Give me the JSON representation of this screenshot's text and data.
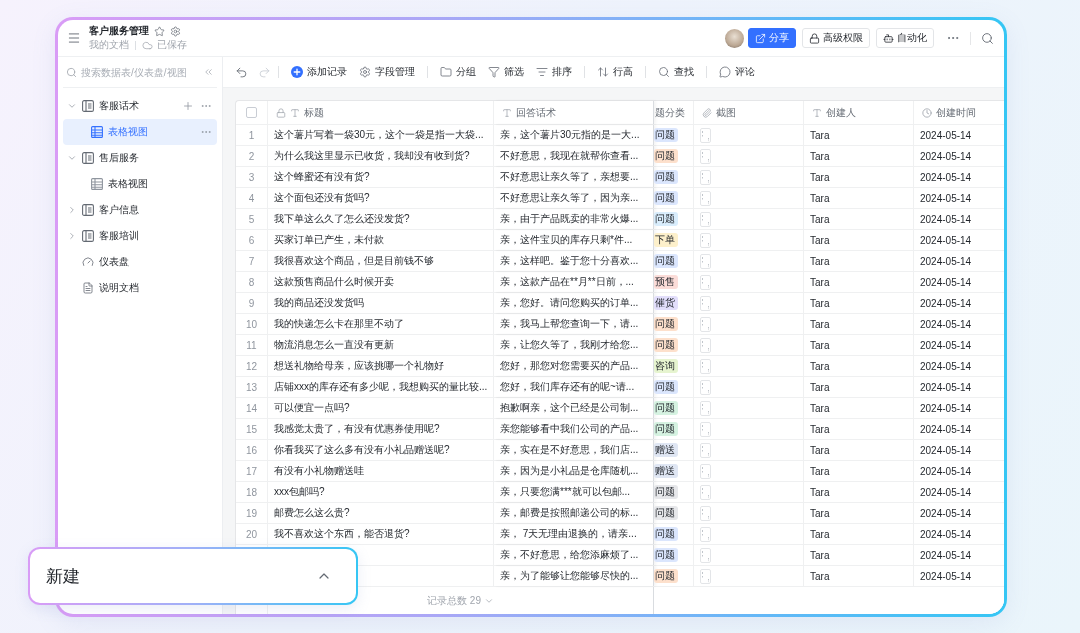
{
  "header": {
    "title": "客户服务管理",
    "location": "我的文档",
    "save_status": "已保存",
    "buttons": [
      {
        "label": "分享",
        "kind": "primary"
      },
      {
        "label": "高级权限",
        "kind": "outline"
      },
      {
        "label": "自动化",
        "kind": "outline"
      }
    ]
  },
  "sidebar": {
    "search": {
      "placeholder": "搜索数据表/仪表盘/视图"
    },
    "items": [
      {
        "label": "客服话术",
        "kind": "table",
        "expanded": true,
        "selected": false,
        "hovered": true,
        "children": [
          {
            "label": "表格视图",
            "kind": "view",
            "selected": true
          }
        ]
      },
      {
        "label": "售后服务",
        "kind": "table",
        "expanded": true,
        "selected": false,
        "hovered": false,
        "children": [
          {
            "label": "表格视图",
            "kind": "view",
            "selected": false
          }
        ]
      },
      {
        "label": "客户信息",
        "kind": "table",
        "expanded": false,
        "selected": false,
        "hovered": false
      },
      {
        "label": "客服培训",
        "kind": "table",
        "expanded": false,
        "selected": false,
        "hovered": false
      },
      {
        "label": "仪表盘",
        "kind": "dashboard",
        "selected": false,
        "hovered": false
      },
      {
        "label": "说明文档",
        "kind": "doc",
        "selected": false,
        "hovered": false
      }
    ]
  },
  "toolbar": {
    "actions": [
      {
        "label": "添加记录"
      },
      {
        "label": "字段管理"
      },
      {
        "label": "分组"
      },
      {
        "label": "筛选"
      },
      {
        "label": "排序"
      },
      {
        "label": "行高"
      },
      {
        "label": "查找"
      },
      {
        "label": "评论"
      }
    ]
  },
  "table": {
    "header_checkbox": {
      "checked": false
    },
    "columns": [
      {
        "label": "标题",
        "kind": "primary"
      },
      {
        "label": "回答话术",
        "kind": "text"
      },
      {
        "label": "题分类",
        "kind": "select"
      },
      {
        "label": "截图",
        "kind": "attachment"
      },
      {
        "label": "创建人",
        "kind": "text"
      },
      {
        "label": "创建时间",
        "kind": "date"
      }
    ],
    "rows": [
      {
        "number": "1",
        "title": "这个薯片写着一袋30元，这个一袋是指一大袋...",
        "answer": "亲，这个薯片30元指的是一大...",
        "category": {
          "label": "问题",
          "color": "#dbe6fd"
        },
        "creator": "Tara",
        "created": "2024-05-14"
      },
      {
        "number": "2",
        "title": "为什么我这里显示已收货，我却没有收到货?",
        "answer": "不好意思，我现在就帮你查看...",
        "category": {
          "label": "问题",
          "color": "#fde0cc"
        },
        "creator": "Tara",
        "created": "2024-05-14"
      },
      {
        "number": "3",
        "title": "这个蜂蜜还有没有货?",
        "answer": "不好意思让亲久等了，亲想要...",
        "category": {
          "label": "问题",
          "color": "#dbe6fd"
        },
        "creator": "Tara",
        "created": "2024-05-14"
      },
      {
        "number": "4",
        "title": "这个面包还没有货吗?",
        "answer": "不好意思让亲久等了，因为亲...",
        "category": {
          "label": "问题",
          "color": "#dbe6fd"
        },
        "creator": "Tara",
        "created": "2024-05-14"
      },
      {
        "number": "5",
        "title": "我下单这么久了怎么还没发货?",
        "answer": "亲，由于产品既卖的非常火爆...",
        "category": {
          "label": "问题",
          "color": "#d9edfc"
        },
        "creator": "Tara",
        "created": "2024-05-14"
      },
      {
        "number": "6",
        "title": "买家订单已产生，未付款",
        "answer": "亲，这件宝贝的库存只剩*件...",
        "category": {
          "label": "下单",
          "color": "#fdf0cb"
        },
        "creator": "Tara",
        "created": "2024-05-14"
      },
      {
        "number": "7",
        "title": "我很喜欢这个商品，但是目前钱不够",
        "answer": "亲，这样吧。鉴于您十分喜欢...",
        "category": {
          "label": "问题",
          "color": "#dbe6fd"
        },
        "creator": "Tara",
        "created": "2024-05-14"
      },
      {
        "number": "8",
        "title": "这款预售商品什么时候开卖",
        "answer": "亲，这款产品在**月**日前，...",
        "category": {
          "label": "预售",
          "color": "#fbdcd8"
        },
        "creator": "Tara",
        "created": "2024-05-14"
      },
      {
        "number": "9",
        "title": "我的商品还没发货吗",
        "answer": "亲，您好。请问您购买的订单...",
        "category": {
          "label": "催货",
          "color": "#e2defb"
        },
        "creator": "Tara",
        "created": "2024-05-14"
      },
      {
        "number": "10",
        "title": "我的快递怎么卡在那里不动了",
        "answer": "亲，我马上帮您查询一下，请...",
        "category": {
          "label": "问题",
          "color": "#fde0cc"
        },
        "creator": "Tara",
        "created": "2024-05-14"
      },
      {
        "number": "11",
        "title": "物流消息怎么一直没有更新",
        "answer": "亲，让您久等了，我刚才给您...",
        "category": {
          "label": "问题",
          "color": "#fde0cc"
        },
        "creator": "Tara",
        "created": "2024-05-14"
      },
      {
        "number": "12",
        "title": "想送礼物给母亲，应该挑哪一个礼物好",
        "answer": "您好，那您对您需要买的产品...",
        "category": {
          "label": "咨询",
          "color": "#e6f4cf"
        },
        "creator": "Tara",
        "created": "2024-05-14"
      },
      {
        "number": "13",
        "title": "店铺xxx的库存还有多少呢，我想购买的量比较...",
        "answer": "您好，我们库存还有的呢~请...",
        "category": {
          "label": "问题",
          "color": "#dbe6fd"
        },
        "creator": "Tara",
        "created": "2024-05-14"
      },
      {
        "number": "14",
        "title": "可以便宜一点吗?",
        "answer": "抱歉啊亲，这个已经是公司制...",
        "category": {
          "label": "问题",
          "color": "#d5f2e1"
        },
        "creator": "Tara",
        "created": "2024-05-14"
      },
      {
        "number": "15",
        "title": "我感觉太贵了，有没有优惠券使用呢?",
        "answer": "亲您能够看中我们公司的产品...",
        "category": {
          "label": "问题",
          "color": "#d5f2e1"
        },
        "creator": "Tara",
        "created": "2024-05-14"
      },
      {
        "number": "16",
        "title": "你看我买了这么多有没有小礼品赠送呢?",
        "answer": "亲，实在是不好意思，我们店...",
        "category": {
          "label": "赠送",
          "color": "#dfe6f3"
        },
        "creator": "Tara",
        "created": "2024-05-14"
      },
      {
        "number": "17",
        "title": "有没有小礼物赠送哇",
        "answer": "亲，因为是小礼品是仓库随机...",
        "category": {
          "label": "赠送",
          "color": "#dfe6f3"
        },
        "creator": "Tara",
        "created": "2024-05-14"
      },
      {
        "number": "18",
        "title": "xxx包邮吗?",
        "answer": "亲，只要您满***就可以包邮...",
        "category": {
          "label": "问题",
          "color": "#e6e7ea"
        },
        "creator": "Tara",
        "created": "2024-05-14"
      },
      {
        "number": "19",
        "title": "邮费怎么这么贵?",
        "answer": "亲，邮费是按照邮递公司的标...",
        "category": {
          "label": "问题",
          "color": "#e6e7ea"
        },
        "creator": "Tara",
        "created": "2024-05-14"
      },
      {
        "number": "20",
        "title": "我不喜欢这个东西，能否退货?",
        "answer": "亲， 7天无理由退换的，请亲...",
        "category": {
          "label": "问题",
          "color": "#dbe6fd"
        },
        "creator": "Tara",
        "created": "2024-05-14"
      },
      {
        "answer": "亲，不好意思，给您添麻烦了...",
        "category": {
          "label": "问题",
          "color": "#dbe6fd"
        },
        "creator": "Tara",
        "created": "2024-05-14"
      },
      {
        "answer": "亲，为了能够让您能够尽快的...",
        "category": {
          "label": "问题",
          "color": "#fde0cc"
        },
        "creator": "Tara",
        "created": "2024-05-14"
      }
    ],
    "footer": "记录总数 29"
  },
  "new_panel": {
    "label": "新建"
  }
}
